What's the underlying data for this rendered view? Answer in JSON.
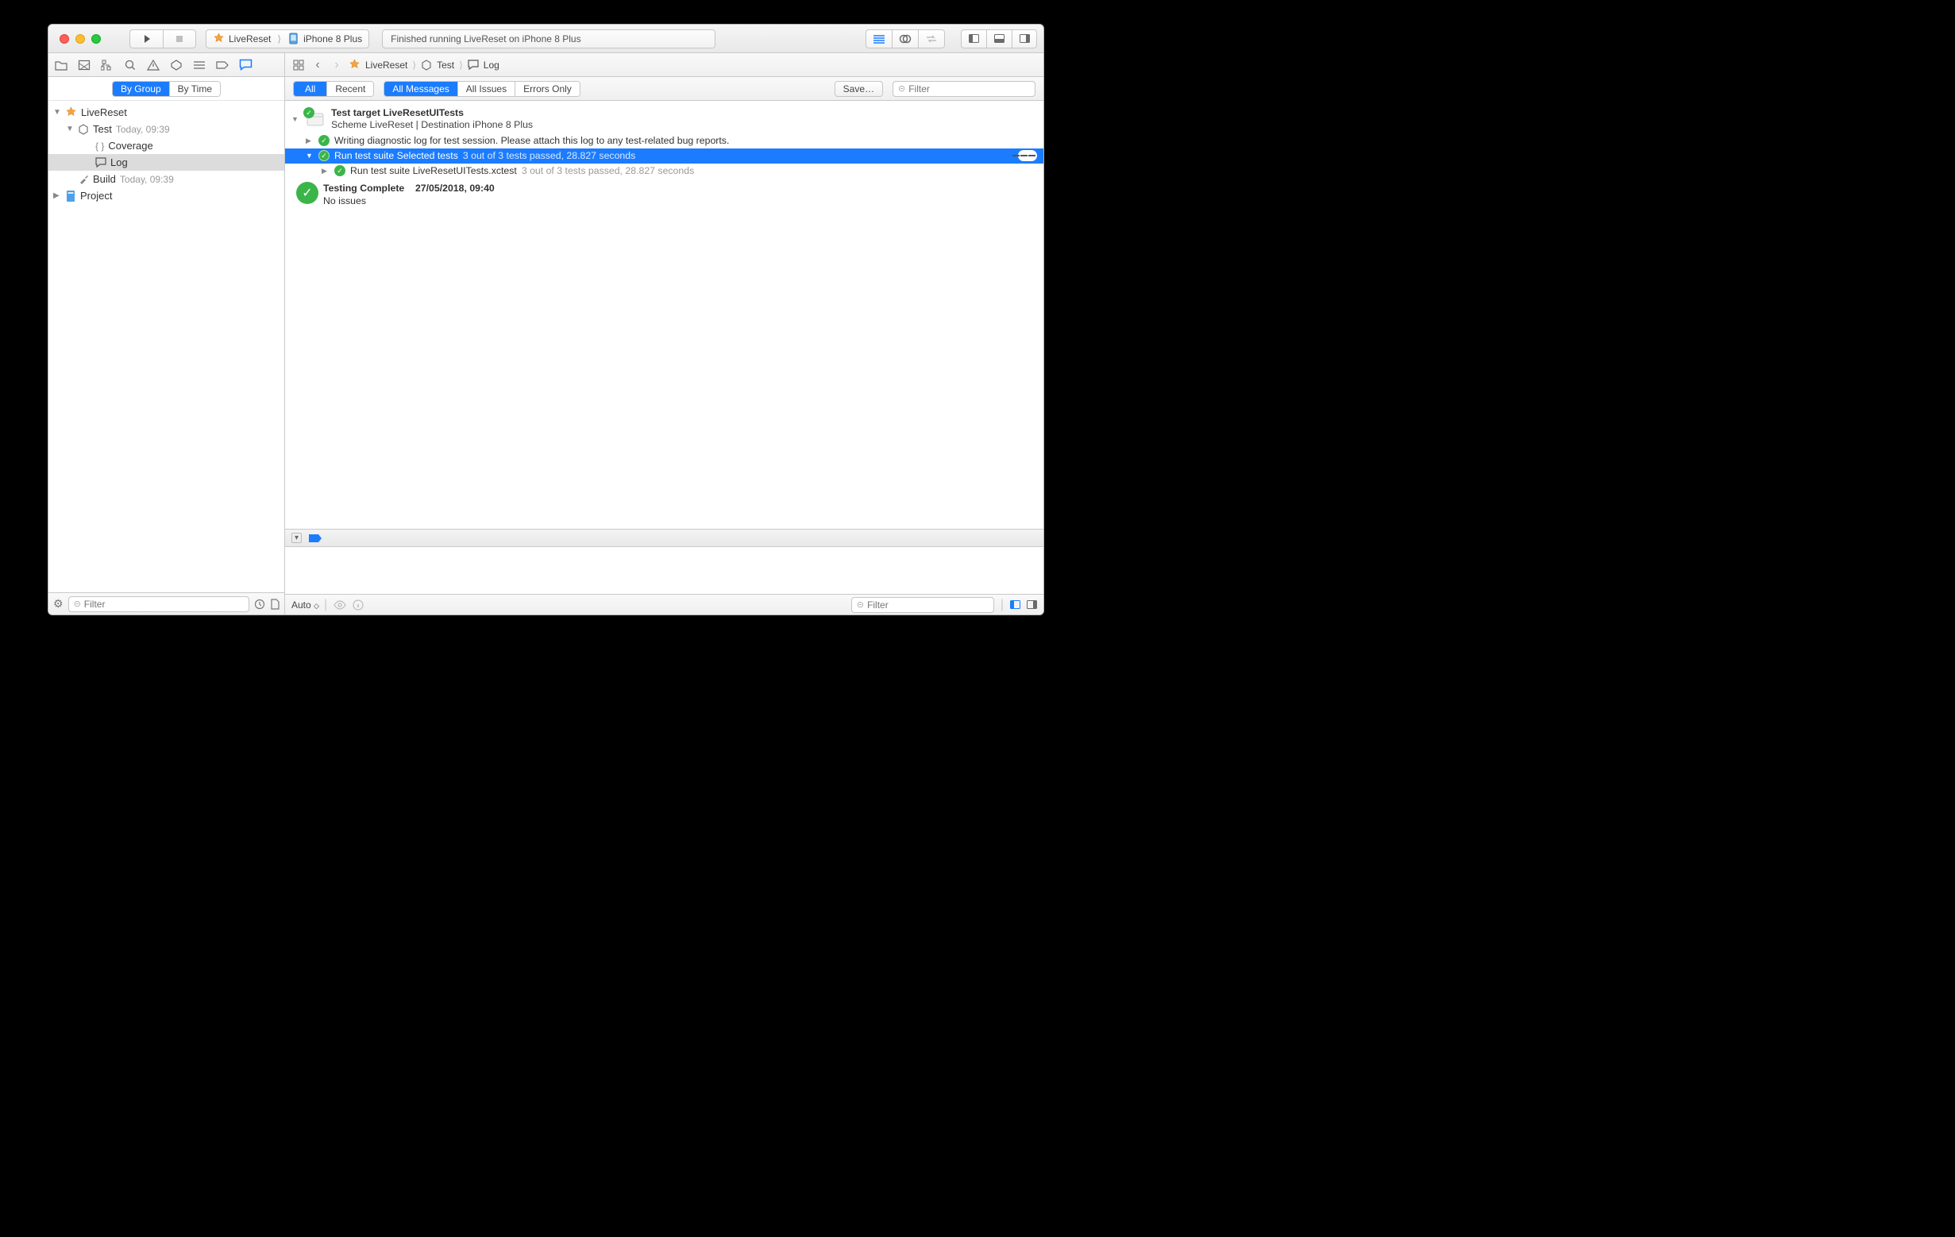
{
  "titlebar": {
    "scheme_project": "LiveReset",
    "scheme_device": "iPhone 8 Plus",
    "status_text": "Finished running LiveReset on iPhone 8 Plus"
  },
  "pathbar": {
    "back_icon": "chevron-left-icon",
    "fwd_icon": "chevron-right-icon",
    "segments": [
      "LiveReset",
      "Test",
      "Log"
    ]
  },
  "sidebar": {
    "seg": {
      "by_group": "By Group",
      "by_time": "By Time"
    },
    "tree": {
      "root": {
        "label": "LiveReset"
      },
      "test": {
        "label": "Test",
        "time": "Today, 09:39"
      },
      "coverage": {
        "label": "Coverage"
      },
      "log": {
        "label": "Log"
      },
      "build": {
        "label": "Build",
        "time": "Today, 09:39"
      },
      "project": {
        "label": "Project"
      }
    },
    "filter_placeholder": "Filter"
  },
  "filterbar": {
    "scope": {
      "all": "All",
      "recent": "Recent"
    },
    "msg": {
      "all_messages": "All Messages",
      "all_issues": "All Issues",
      "errors_only": "Errors Only"
    },
    "save": "Save…",
    "filter_placeholder": "Filter"
  },
  "log": {
    "header_title": "Test target LiveResetUITests",
    "header_sub": "Scheme LiveReset | Destination iPhone 8 Plus",
    "diag_line": "Writing diagnostic log for test session. Please attach this log to any test-related bug reports.",
    "suite_line_a": "Run test suite Selected tests",
    "suite_line_b": "3 out of 3 tests passed, 28.827 seconds",
    "sub_suite_a": "Run test suite LiveResetUITests.xctest",
    "sub_suite_b": "3 out of 3 tests passed, 28.827 seconds",
    "complete_label": "Testing Complete",
    "complete_time": "27/05/2018, 09:40",
    "complete_sub": "No issues"
  },
  "console": {
    "auto_label": "Auto",
    "filter_placeholder": "Filter"
  }
}
